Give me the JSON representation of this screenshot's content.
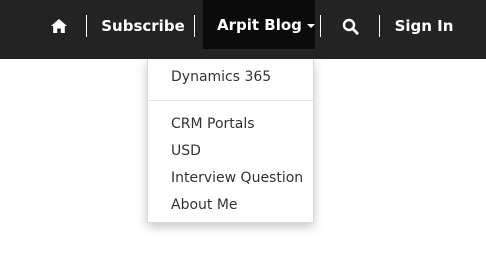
{
  "navbar": {
    "home_icon": "home-icon",
    "subscribe_label": "Subscribe",
    "blog_label": "Arpit Blog",
    "search_icon": "search-icon",
    "signin_label": "Sign In"
  },
  "dropdown": {
    "items": [
      "Dynamics 365",
      "CRM Portals",
      "USD",
      "Interview Question",
      "About Me"
    ]
  },
  "colors": {
    "navbar_bg": "#232323",
    "active_bg": "#0b0b0b",
    "text_light": "#ffffff",
    "dropdown_text": "#333333"
  }
}
